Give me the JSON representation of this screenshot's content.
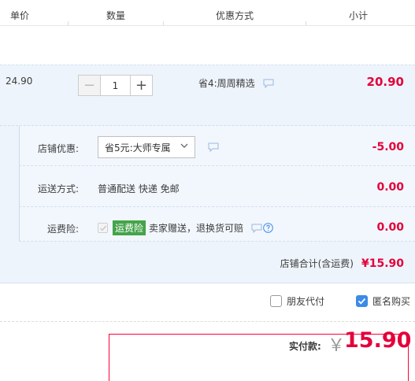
{
  "table_header": {
    "columns": [
      "单价",
      "数量",
      "优惠方式",
      "小计"
    ]
  },
  "item": {
    "unit_price": "24.90",
    "quantity": "1",
    "minus_label": "−",
    "plus_label": "+",
    "promotion": "省4:周周精选",
    "subtotal": "20.90"
  },
  "shop": {
    "discount": {
      "label": "店铺优惠:",
      "selected": "省5元:大师专属",
      "value": "-5.00"
    },
    "shipping": {
      "label": "运送方式:",
      "method": "普通配送 快递 免邮",
      "value": "0.00"
    },
    "insurance": {
      "label": "运费险:",
      "badge": "运费险",
      "text": "卖家赠送，退换货可赔",
      "value": "0.00"
    },
    "total_label": "店铺合计(含运费)",
    "total_value": "¥15.90"
  },
  "options": {
    "friend_pay": "朋友代付",
    "anonymous": "匿名购买"
  },
  "payment": {
    "label": "实付款:",
    "currency": "￥",
    "amount": "15.90"
  },
  "colors": {
    "accent_red": "#e4003a",
    "row_bg": "#eef4fb",
    "checkbox_blue": "#3b8be8",
    "badge_green": "#45a34a"
  }
}
